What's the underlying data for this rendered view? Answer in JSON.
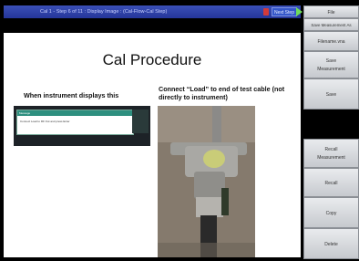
{
  "titlebar": {
    "title": "Cal 1 - Step 6 of 11 : Display Image : (Cal-Flow-Cal Step)",
    "next_label": "Next Step"
  },
  "slide": {
    "title": "Cal Procedure",
    "caption_left": "When instrument displays this",
    "caption_right": "Connect “Load” to end of test cable (not directly to instrument)",
    "mini_dialog_header": "Message",
    "mini_dialog_text": "Connect Load to RF Out and press Enter"
  },
  "softkeys": [
    {
      "label": "File"
    },
    {
      "label": "Save Measurement As"
    },
    {
      "label": "Filename.vna"
    },
    {
      "label": "Save",
      "label2": "Measurement"
    },
    {
      "label": "Save"
    },
    {
      "label": "Recall",
      "label2": "Measurement"
    },
    {
      "label": "Recall"
    },
    {
      "label": "Copy"
    },
    {
      "label": "Delete"
    }
  ],
  "colors": {
    "titlebar": "#25369a",
    "next_arrow": "#6fdc5a",
    "softkey_bg": "#d7dadf"
  }
}
